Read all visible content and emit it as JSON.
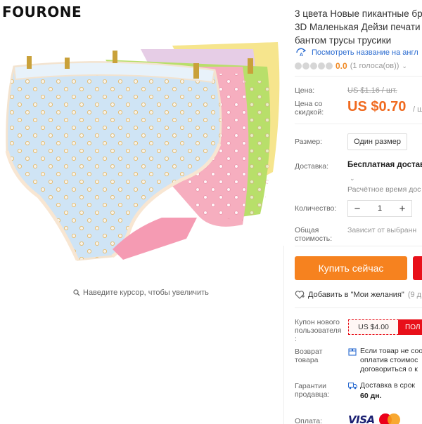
{
  "brand": {
    "logo_text": "FOURONE"
  },
  "gallery": {
    "zoom_hint": "Наведите курсор, чтобы увеличить"
  },
  "product": {
    "title_lines": [
      "3 цвета Новые пикантные бр",
      "3D Маленькая Дейзи печати",
      "бантом трусы трусики"
    ],
    "translate_link": "Посмотреть название на англ",
    "rating": {
      "value": "0.0",
      "votes": "(1 голоса(ов))",
      "stars_filled": 0,
      "stars_total": 5
    }
  },
  "pricing": {
    "price_label": "Цена:",
    "old_price": "US $1.16 / шт.",
    "discount_label_lines": [
      "Цена со",
      "скидкой:"
    ],
    "new_price": "US $0.70",
    "new_price_unit": "/ шт"
  },
  "options": {
    "size_label": "Размер:",
    "size_value": "Один размер",
    "delivery_label": "Доставка:",
    "delivery_value": "Бесплатная доставк",
    "delivery_estimate": "Расчётное время дос",
    "quantity_label": "Количество:",
    "quantity_value": "1",
    "total_label_lines": [
      "Общая",
      "стоимость:"
    ],
    "total_value": "Зависит от выбранн"
  },
  "actions": {
    "buy_now": "Купить сейчас",
    "wishlist": "Добавить в \"Мои желания\"",
    "wishlist_count": "(9 д"
  },
  "coupon": {
    "label_lines": [
      "Купон нового",
      "пользователя",
      ":"
    ],
    "value": "US $4.00",
    "button": "ПОЛ"
  },
  "returns": {
    "label_lines": [
      "Возврат",
      "товара"
    ],
    "text_lines": [
      "Если товар не соо",
      "оплатив стоимос",
      "договориться о к"
    ]
  },
  "guarantee": {
    "label_lines": [
      "Гарантии",
      "продавца:"
    ],
    "text": "Доставка в срок",
    "days": "60 дн."
  },
  "payment": {
    "label": "Оплата:",
    "methods": [
      "VISA",
      "MasterCard"
    ]
  },
  "colors": {
    "accent_orange": "#f6821f",
    "price_orange": "#f06a1f",
    "cart_red": "#e8101a",
    "link_blue": "#2a6bd0",
    "rating_orange": "#f08a24"
  },
  "icons": {
    "zoom": "magnifier-icon",
    "translate": "translate-icon",
    "wishlist": "heart-plus-icon",
    "returns": "return-box-icon",
    "guarantee": "truck-icon"
  }
}
